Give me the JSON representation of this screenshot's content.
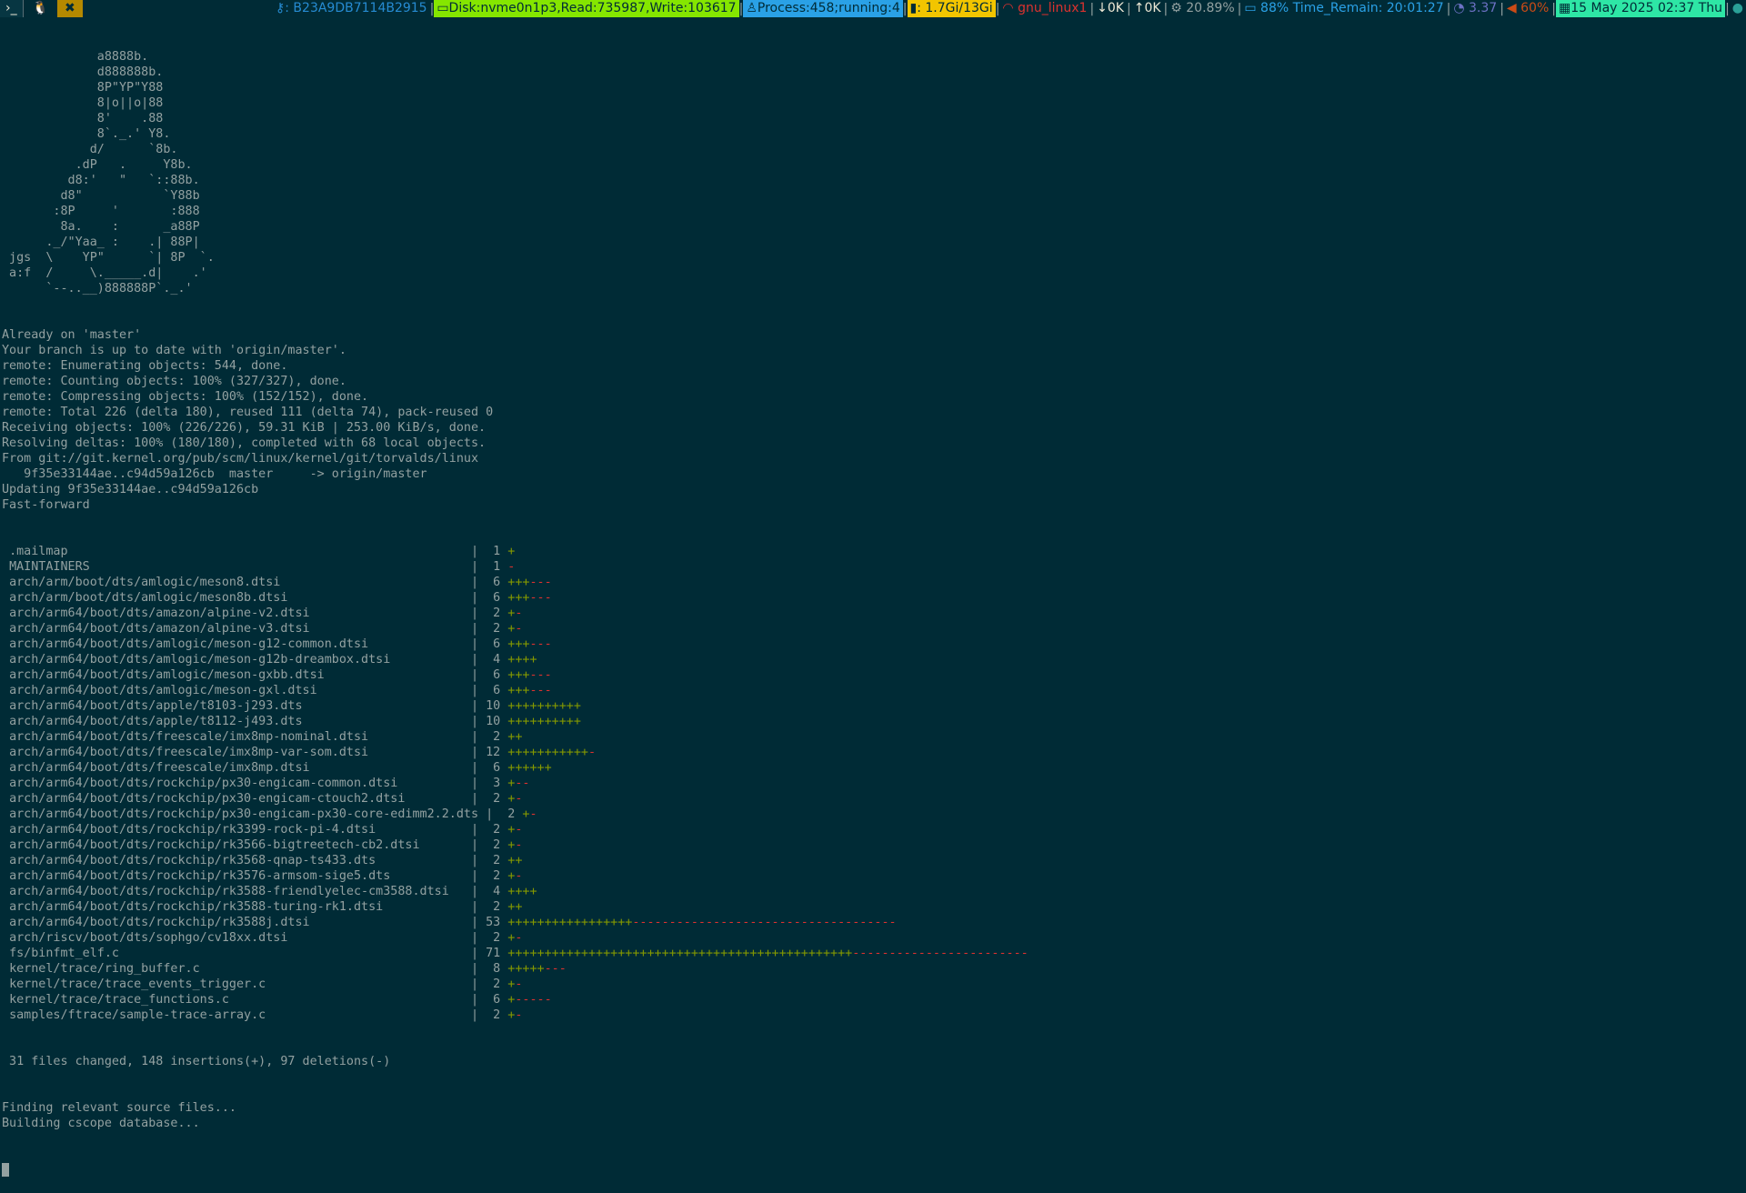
{
  "topbar": {
    "tags": [
      "›_",
      "🐧",
      "✖"
    ],
    "segments": [
      {
        "icon": "key-icon",
        "text": ": B23A9DB7114B2915",
        "fg": "#268bd2",
        "bg": ""
      },
      {
        "icon": "disk-icon",
        "text": "Disk:nvme0n1p3,Read:735987,Write:103617",
        "fg": "#002b36",
        "bg": "#85e600"
      },
      {
        "icon": "penguin-icon",
        "text": "Process:458;running:4",
        "fg": "#002b36",
        "bg": "#2aa1e6"
      },
      {
        "icon": "chart-icon",
        "text": ": 1.7Gi/13Gi",
        "fg": "#002b36",
        "bg": "#f2c500"
      },
      {
        "icon": "wifi-icon",
        "text": " gnu_linux1",
        "fg": "#dc322f",
        "bg": ""
      },
      {
        "icon": "download-icon",
        "text": "0K",
        "fg": "#eee8d5",
        "bg": ""
      },
      {
        "icon": "upload-icon",
        "text": "0K",
        "fg": "#eee8d5",
        "bg": ""
      },
      {
        "icon": "cpu-gear-icon",
        "text": " 20.89%",
        "fg": "#93a1a1",
        "bg": ""
      },
      {
        "icon": "battery-icon",
        "text": " 88% Time_Remain: 20:01:27",
        "fg": "#2aa1e6",
        "bg": ""
      },
      {
        "icon": "load-gauge-icon",
        "text": " 3.37",
        "fg": "#6c71c4",
        "bg": ""
      },
      {
        "icon": "volume-icon",
        "text": " 60%",
        "fg": "#cb4b16",
        "bg": ""
      },
      {
        "icon": "calendar-icon",
        "text": "15 May 2025 02:37 Thu",
        "fg": "#002b36",
        "bg": "#2ee6a5"
      },
      {
        "icon": "tray-icon",
        "text": "",
        "fg": "#2aa198",
        "bg": ""
      }
    ]
  },
  "terminal": {
    "ascii_art": [
      "             a8888b.",
      "             d888888b.",
      "             8P\"YP\"Y88",
      "             8|o||o|88",
      "             8'    .88",
      "             8`._.' Y8.",
      "            d/      `8b.",
      "          .dP   .     Y8b.",
      "         d8:'   \"   `::88b.",
      "        d8\"           `Y88b",
      "       :8P     '       :888",
      "        8a.    :      _a88P",
      "      ._/\"Yaa_ :    .| 88P|",
      " jgs  \\    YP\"      `| 8P  `.",
      " a:f  /     \\._____.d|    .'",
      "      `--..__)888888P`._.'"
    ],
    "git_output": [
      "Already on 'master'",
      "Your branch is up to date with 'origin/master'.",
      "remote: Enumerating objects: 544, done.",
      "remote: Counting objects: 100% (327/327), done.",
      "remote: Compressing objects: 100% (152/152), done.",
      "remote: Total 226 (delta 180), reused 111 (delta 74), pack-reused 0",
      "Receiving objects: 100% (226/226), 59.31 KiB | 253.00 KiB/s, done.",
      "Resolving deltas: 100% (180/180), completed with 68 local objects.",
      "From git://git.kernel.org/pub/scm/linux/kernel/git/torvalds/linux",
      "   9f35e33144ae..c94d59a126cb  master     -> origin/master",
      "Updating 9f35e33144ae..c94d59a126cb",
      "Fast-forward"
    ],
    "diffstat": [
      {
        "file": ".mailmap",
        "count": "1",
        "plus": "+",
        "minus": ""
      },
      {
        "file": "MAINTAINERS",
        "count": "1",
        "plus": "",
        "minus": "-"
      },
      {
        "file": "arch/arm/boot/dts/amlogic/meson8.dtsi",
        "count": "6",
        "plus": "+++",
        "minus": "---"
      },
      {
        "file": "arch/arm/boot/dts/amlogic/meson8b.dtsi",
        "count": "6",
        "plus": "+++",
        "minus": "---"
      },
      {
        "file": "arch/arm64/boot/dts/amazon/alpine-v2.dtsi",
        "count": "2",
        "plus": "+",
        "minus": "-"
      },
      {
        "file": "arch/arm64/boot/dts/amazon/alpine-v3.dtsi",
        "count": "2",
        "plus": "+",
        "minus": "-"
      },
      {
        "file": "arch/arm64/boot/dts/amlogic/meson-g12-common.dtsi",
        "count": "6",
        "plus": "+++",
        "minus": "---"
      },
      {
        "file": "arch/arm64/boot/dts/amlogic/meson-g12b-dreambox.dtsi",
        "count": "4",
        "plus": "++++",
        "minus": ""
      },
      {
        "file": "arch/arm64/boot/dts/amlogic/meson-gxbb.dtsi",
        "count": "6",
        "plus": "+++",
        "minus": "---"
      },
      {
        "file": "arch/arm64/boot/dts/amlogic/meson-gxl.dtsi",
        "count": "6",
        "plus": "+++",
        "minus": "---"
      },
      {
        "file": "arch/arm64/boot/dts/apple/t8103-j293.dts",
        "count": "10",
        "plus": "++++++++++",
        "minus": ""
      },
      {
        "file": "arch/arm64/boot/dts/apple/t8112-j493.dts",
        "count": "10",
        "plus": "++++++++++",
        "minus": ""
      },
      {
        "file": "arch/arm64/boot/dts/freescale/imx8mp-nominal.dtsi",
        "count": "2",
        "plus": "++",
        "minus": ""
      },
      {
        "file": "arch/arm64/boot/dts/freescale/imx8mp-var-som.dtsi",
        "count": "12",
        "plus": "+++++++++++",
        "minus": "-"
      },
      {
        "file": "arch/arm64/boot/dts/freescale/imx8mp.dtsi",
        "count": "6",
        "plus": "++++++",
        "minus": ""
      },
      {
        "file": "arch/arm64/boot/dts/rockchip/px30-engicam-common.dtsi",
        "count": "3",
        "plus": "+",
        "minus": "--"
      },
      {
        "file": "arch/arm64/boot/dts/rockchip/px30-engicam-ctouch2.dtsi",
        "count": "2",
        "plus": "+",
        "minus": "-"
      },
      {
        "file": "arch/arm64/boot/dts/rockchip/px30-engicam-px30-core-edimm2.2.dts",
        "count": "2",
        "plus": "+",
        "minus": "-"
      },
      {
        "file": "arch/arm64/boot/dts/rockchip/rk3399-rock-pi-4.dtsi",
        "count": "2",
        "plus": "+",
        "minus": "-"
      },
      {
        "file": "arch/arm64/boot/dts/rockchip/rk3566-bigtreetech-cb2.dtsi",
        "count": "2",
        "plus": "+",
        "minus": "-"
      },
      {
        "file": "arch/arm64/boot/dts/rockchip/rk3568-qnap-ts433.dts",
        "count": "2",
        "plus": "++",
        "minus": ""
      },
      {
        "file": "arch/arm64/boot/dts/rockchip/rk3576-armsom-sige5.dts",
        "count": "2",
        "plus": "+",
        "minus": "-"
      },
      {
        "file": "arch/arm64/boot/dts/rockchip/rk3588-friendlyelec-cm3588.dtsi",
        "count": "4",
        "plus": "++++",
        "minus": ""
      },
      {
        "file": "arch/arm64/boot/dts/rockchip/rk3588-turing-rk1.dtsi",
        "count": "2",
        "plus": "++",
        "minus": ""
      },
      {
        "file": "arch/arm64/boot/dts/rockchip/rk3588j.dtsi",
        "count": "53",
        "plus": "+++++++++++++++++",
        "minus": "------------------------------------"
      },
      {
        "file": "arch/riscv/boot/dts/sophgo/cv18xx.dtsi",
        "count": "2",
        "plus": "+",
        "minus": "-"
      },
      {
        "file": "fs/binfmt_elf.c",
        "count": "71",
        "plus": "+++++++++++++++++++++++++++++++++++++++++++++++",
        "minus": "------------------------"
      },
      {
        "file": "kernel/trace/ring_buffer.c",
        "count": "8",
        "plus": "+++++",
        "minus": "---"
      },
      {
        "file": "kernel/trace/trace_events_trigger.c",
        "count": "2",
        "plus": "+",
        "minus": "-"
      },
      {
        "file": "kernel/trace/trace_functions.c",
        "count": "6",
        "plus": "+",
        "minus": "-----"
      },
      {
        "file": "samples/ftrace/sample-trace-array.c",
        "count": "2",
        "plus": "+",
        "minus": "-"
      }
    ],
    "summary": " 31 files changed, 148 insertions(+), 97 deletions(-)",
    "trailing": [
      "Finding relevant source files...",
      "Building cscope database..."
    ],
    "colors": {
      "plus": "#859900",
      "minus": "#dc322f",
      "text": "#93a1a1",
      "background": "#002b36"
    }
  }
}
